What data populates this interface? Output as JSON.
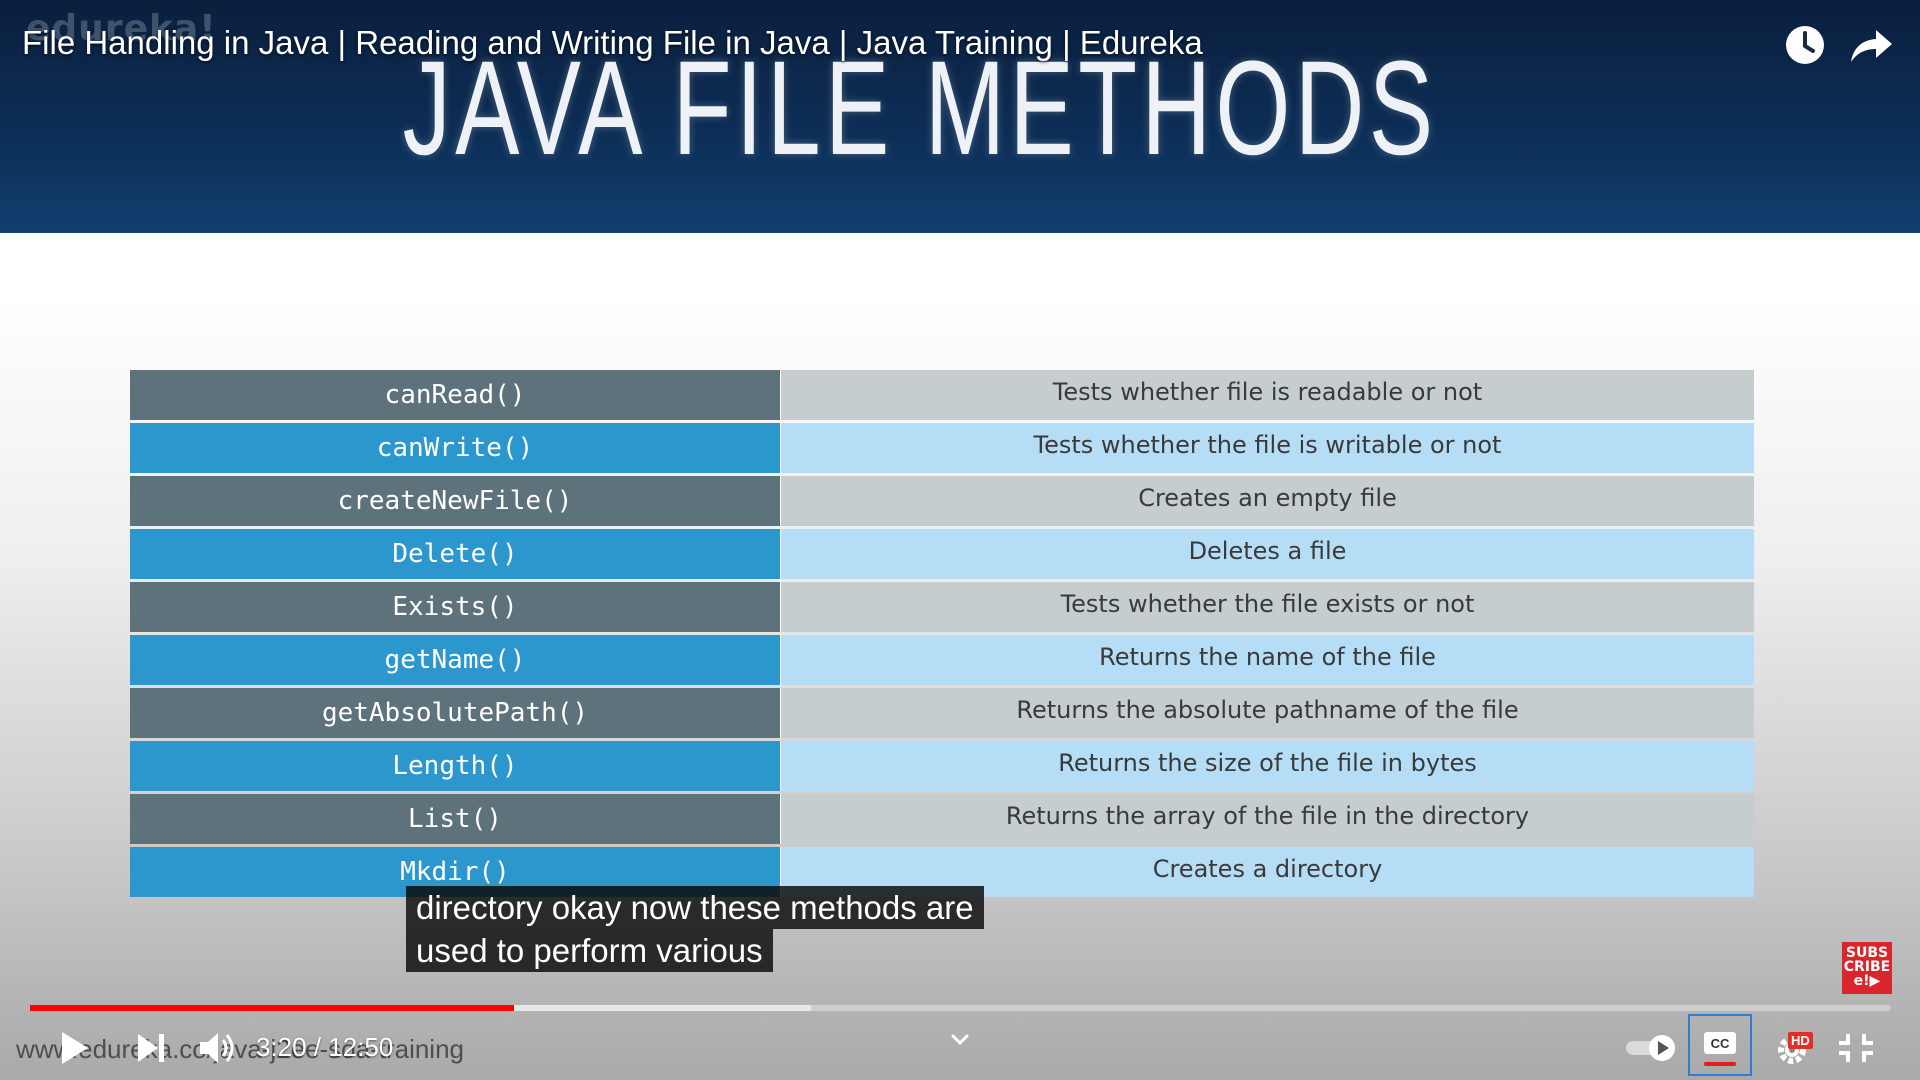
{
  "video": {
    "title": "File Handling in Java | Reading and Writing File in Java | Java Training | Edureka",
    "current_time": "3:20",
    "duration": "12:50",
    "time_separator": " / ",
    "played_fraction": 0.26,
    "buffered_fraction": 0.42
  },
  "slide": {
    "brand_logo": "edureka!",
    "heading": "JAVA FILE METHODS",
    "footer_url": "www.edureka.co/java-j2ee-soa-training",
    "rows": [
      {
        "method": "canRead()",
        "description": "Tests whether file is readable or not"
      },
      {
        "method": "canWrite()",
        "description": "Tests whether the file is writable or not"
      },
      {
        "method": "createNewFile()",
        "description": "Creates an empty file"
      },
      {
        "method": "Delete()",
        "description": "Deletes a file"
      },
      {
        "method": "Exists()",
        "description": "Tests whether the file exists or not"
      },
      {
        "method": "getName()",
        "description": "Returns the name of the file"
      },
      {
        "method": "getAbsolutePath()",
        "description": "Returns the absolute pathname of the file"
      },
      {
        "method": "Length()",
        "description": "Returns the size of the file in bytes"
      },
      {
        "method": "List()",
        "description": "Returns the array of the file in the directory"
      },
      {
        "method": "Mkdir()",
        "description": "Creates a directory"
      }
    ]
  },
  "captions": {
    "lines": [
      "directory okay now these methods are",
      "used to perform various"
    ]
  },
  "subscribe": {
    "line1": "SUBS",
    "line2": "CRIBE",
    "line3": "e!▶"
  },
  "controls": {
    "hd_badge": "HD",
    "cc_label": "CC"
  },
  "icons": {
    "watch_later": "clock-icon",
    "share": "share-arrow-icon",
    "play": "play-icon",
    "next": "skip-next-icon",
    "volume": "volume-icon",
    "chevron": "chevron-down-icon",
    "autoplay": "autoplay-toggle-icon",
    "settings": "gear-icon",
    "fullscreen": "exit-fullscreen-icon"
  },
  "colors": {
    "progress_played": "#ff0000",
    "method_dark": "#5e727b",
    "method_blue": "#2c97cd",
    "desc_dark": "#c5cdcf",
    "desc_blue": "#b5def6",
    "cc_underline": "#e02020",
    "subscribe_red": "#d8262c"
  }
}
